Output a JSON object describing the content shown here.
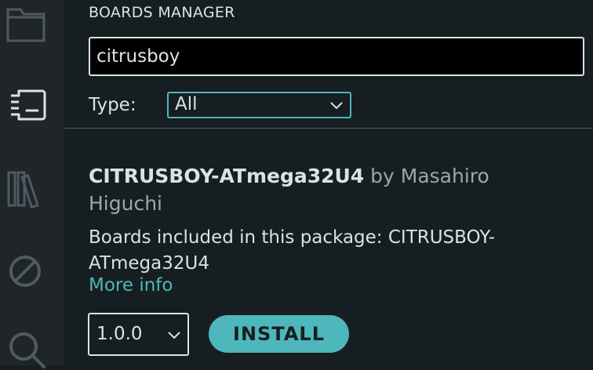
{
  "activity_bar": {
    "icons": [
      "folder-icon",
      "boards-manager-icon",
      "library-icon",
      "debug-icon",
      "search-icon"
    ]
  },
  "boards_manager": {
    "title": "BOARDS MANAGER",
    "search_value": "citrusboy",
    "type_label": "Type:",
    "type_value": "All",
    "board": {
      "name": "CITRUSBOY-ATmega32U4",
      "by_text": "by Masahiro Higuchi",
      "description": "Boards included in this package: CITRUSBOY-ATmega32U4",
      "more_info": "More info",
      "version": "1.0.0",
      "install_label": "INSTALL"
    }
  },
  "colors": {
    "background": "#171e21",
    "activity_bar": "#1f2529",
    "text": "#dae3e3",
    "muted_text": "#9ba7a9",
    "accent": "#4db7bb"
  }
}
